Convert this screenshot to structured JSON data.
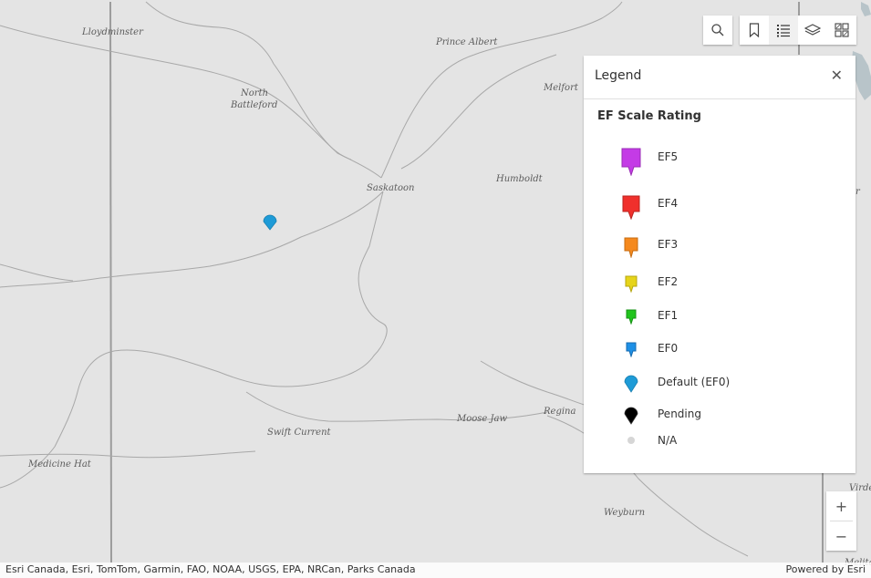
{
  "map": {
    "places": [
      {
        "key": "lloydminster",
        "label": "Lloydminster"
      },
      {
        "key": "prince_albert",
        "label": "Prince Albert"
      },
      {
        "key": "north",
        "label": "North"
      },
      {
        "key": "battleford",
        "label": "Battleford"
      },
      {
        "key": "melfort",
        "label": "Melfort"
      },
      {
        "key": "humboldt",
        "label": "Humboldt"
      },
      {
        "key": "saskatoon",
        "label": "Saskatoon"
      },
      {
        "key": "swift_current",
        "label": "Swift Current"
      },
      {
        "key": "moose_jaw",
        "label": "Moose Jaw"
      },
      {
        "key": "regina",
        "label": "Regina"
      },
      {
        "key": "medicine_hat",
        "label": "Medicine Hat"
      },
      {
        "key": "weyburn",
        "label": "Weyburn"
      },
      {
        "key": "yorkton_partial",
        "label": "r"
      },
      {
        "key": "virden_partial",
        "label": "Virde"
      },
      {
        "key": "melita_partial",
        "label": "Melita"
      }
    ],
    "marker": {
      "category": "Default (EF0)",
      "color": "#1e9bd7"
    }
  },
  "toolbar": {
    "search_icon": "search-icon",
    "bookmarks_icon": "bookmark-icon",
    "legend_icon": "legend-list-icon",
    "layers_icon": "layers-icon",
    "basemap_icon": "basemap-gallery-icon"
  },
  "legend": {
    "title": "Legend",
    "close_icon": "close-icon",
    "layer_title": "EF Scale Rating",
    "items": [
      {
        "label": "EF5",
        "color": "#c43be6"
      },
      {
        "label": "EF4",
        "color": "#f0302c"
      },
      {
        "label": "EF3",
        "color": "#f5891d"
      },
      {
        "label": "EF2",
        "color": "#e6d41a"
      },
      {
        "label": "EF1",
        "color": "#20c41c"
      },
      {
        "label": "EF0",
        "color": "#1e90e6"
      },
      {
        "label": "Default (EF0)",
        "color": "#1e9bd7"
      },
      {
        "label": "Pending",
        "color": "#000000"
      },
      {
        "label": "N/A",
        "color": "#d6d6d6"
      }
    ]
  },
  "zoom": {
    "in_label": "+",
    "out_label": "−"
  },
  "attribution": {
    "text": "Esri Canada, Esri, TomTom, Garmin, FAO, NOAA, USGS, EPA, NRCan, Parks Canada",
    "powered": "Powered by Esri"
  }
}
